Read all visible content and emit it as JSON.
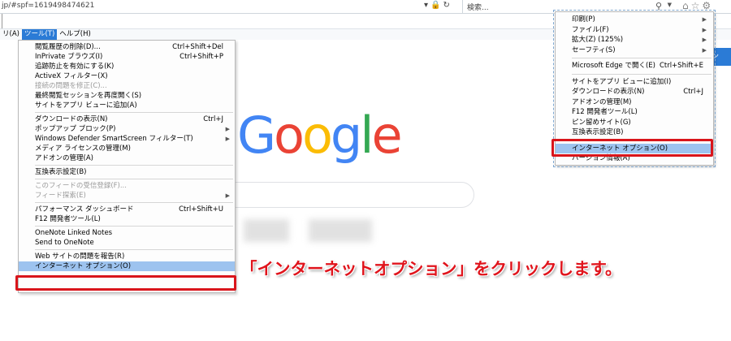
{
  "address_bar": {
    "url": "jp/#spf=1619498474621",
    "icons": [
      "dropdown-icon",
      "lock-icon",
      "refresh-icon"
    ]
  },
  "search": {
    "placeholder": "検索..."
  },
  "menubar": {
    "items": [
      {
        "label": "リ(A)"
      },
      {
        "label": "ツール(T)",
        "active": true
      },
      {
        "label": "ヘルプ(H)"
      }
    ]
  },
  "tools_menu": {
    "groups": [
      [
        {
          "label": "閲覧履歴の削除(D)...",
          "shortcut": "Ctrl+Shift+Del"
        },
        {
          "label": "InPrivate ブラウズ(I)",
          "shortcut": "Ctrl+Shift+P"
        },
        {
          "label": "追跡防止を有効にする(K)"
        },
        {
          "label": "ActiveX フィルター(X)"
        },
        {
          "label": "接続の問題を修正(C)...",
          "disabled": true
        },
        {
          "label": "最終閲覧セッションを再度開く(S)"
        },
        {
          "label": "サイトをアプリ ビューに追加(A)"
        }
      ],
      [
        {
          "label": "ダウンロードの表示(N)",
          "shortcut": "Ctrl+J"
        },
        {
          "label": "ポップアップ ブロック(P)",
          "submenu": true
        },
        {
          "label": "Windows Defender SmartScreen フィルター(T)",
          "submenu": true
        },
        {
          "label": "メディア ライセンスの管理(M)"
        },
        {
          "label": "アドオンの管理(A)"
        }
      ],
      [
        {
          "label": "互換表示設定(B)"
        }
      ],
      [
        {
          "label": "このフィードの受信登録(F)...",
          "disabled": true
        },
        {
          "label": "フィード探索(E)",
          "disabled": true,
          "submenu": true
        }
      ],
      [
        {
          "label": "パフォーマンス ダッシュボード",
          "shortcut": "Ctrl+Shift+U"
        },
        {
          "label": "F12 開発者ツール(L)"
        }
      ],
      [
        {
          "label": "OneNote Linked Notes"
        },
        {
          "label": "Send to OneNote"
        }
      ],
      [
        {
          "label": "Web サイトの問題を報告(R)"
        },
        {
          "label": "インターネット オプション(O)",
          "highlighted": true
        }
      ]
    ]
  },
  "gear_menu": {
    "groups": [
      [
        {
          "label": "印刷(P)",
          "submenu": true
        },
        {
          "label": "ファイル(F)",
          "submenu": true
        },
        {
          "label": "拡大(Z) (125%)",
          "submenu": true
        },
        {
          "label": "セーフティ(S)",
          "submenu": true
        }
      ],
      [
        {
          "label": "Microsoft Edge で開く(E)",
          "shortcut": "Ctrl+Shift+E"
        }
      ],
      [
        {
          "label": "サイトをアプリ ビューに追加(I)"
        },
        {
          "label": "ダウンロードの表示(N)",
          "shortcut": "Ctrl+J"
        },
        {
          "label": "アドオンの管理(M)"
        },
        {
          "label": "F12 開発者ツール(L)"
        },
        {
          "label": "ピン留めサイト(G)"
        },
        {
          "label": "互換表示設定(B)"
        }
      ],
      [
        {
          "label": "インターネット オプション(O)",
          "highlighted": true
        },
        {
          "label": "バージョン情報(A)"
        }
      ]
    ]
  },
  "google": {
    "letters": [
      {
        "char": "G",
        "color": "#4285f4"
      },
      {
        "char": "o",
        "color": "#ea4335"
      },
      {
        "char": "o",
        "color": "#fbbc05"
      },
      {
        "char": "g",
        "color": "#4285f4"
      },
      {
        "char": "l",
        "color": "#34a853"
      },
      {
        "char": "e",
        "color": "#ea4335"
      }
    ]
  },
  "right_button_label": "ン",
  "caption": "「インターネットオプション」をクリックします。",
  "colors": {
    "accent": "#2b7bd6",
    "highlight": "#9dc3ef",
    "annotation_red": "#d9151b"
  }
}
